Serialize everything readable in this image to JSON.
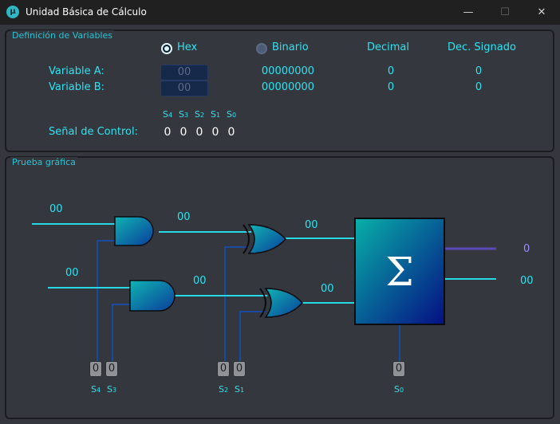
{
  "window": {
    "title": "Unidad Básica de Cálculo",
    "icon": "µ",
    "minimize": "—",
    "maximize": "☐",
    "close": "✕"
  },
  "definition": {
    "title": "Definición de Variables",
    "radio_hex": "Hex",
    "radio_bin": "Binario",
    "col_decimal": "Decimal",
    "col_signed": "Dec. Signado",
    "var_a": {
      "label": "Variable A:",
      "hex": "00",
      "bin": "00000000",
      "dec": "0",
      "signed": "0"
    },
    "var_b": {
      "label": "Variable B:",
      "hex": "00",
      "bin": "00000000",
      "dec": "0",
      "signed": "0"
    },
    "control_label": "Señal de Control:",
    "control_bits": [
      {
        "s": "S",
        "n": "4",
        "v": "0"
      },
      {
        "s": "S",
        "n": "3",
        "v": "0"
      },
      {
        "s": "S",
        "n": "2",
        "v": "0"
      },
      {
        "s": "S",
        "n": "1",
        "v": "0"
      },
      {
        "s": "S",
        "n": "0",
        "v": "0"
      }
    ]
  },
  "test": {
    "title": "Prueba gráfica",
    "in_a": "00",
    "in_b": "00",
    "and_top_out": "00",
    "and_bot_out": "00",
    "xor_top_out": "00",
    "xor_bot_out": "00",
    "sum_symbol": "Σ",
    "carry_out": "0",
    "result_out": "00",
    "toggles": [
      {
        "v": "0",
        "s": "S",
        "n": "4"
      },
      {
        "v": "0",
        "s": "S",
        "n": "3"
      },
      {
        "v": "0",
        "s": "S",
        "n": "2"
      },
      {
        "v": "0",
        "s": "S",
        "n": "1"
      },
      {
        "v": "0",
        "s": "S",
        "n": "0"
      }
    ]
  },
  "colors": {
    "accent": "#2ee3f2",
    "wire": "#27d9e6",
    "control_wire": "#1a4aa0",
    "carry_wire": "#5a4ab8",
    "carry_text": "#9a8cff"
  }
}
